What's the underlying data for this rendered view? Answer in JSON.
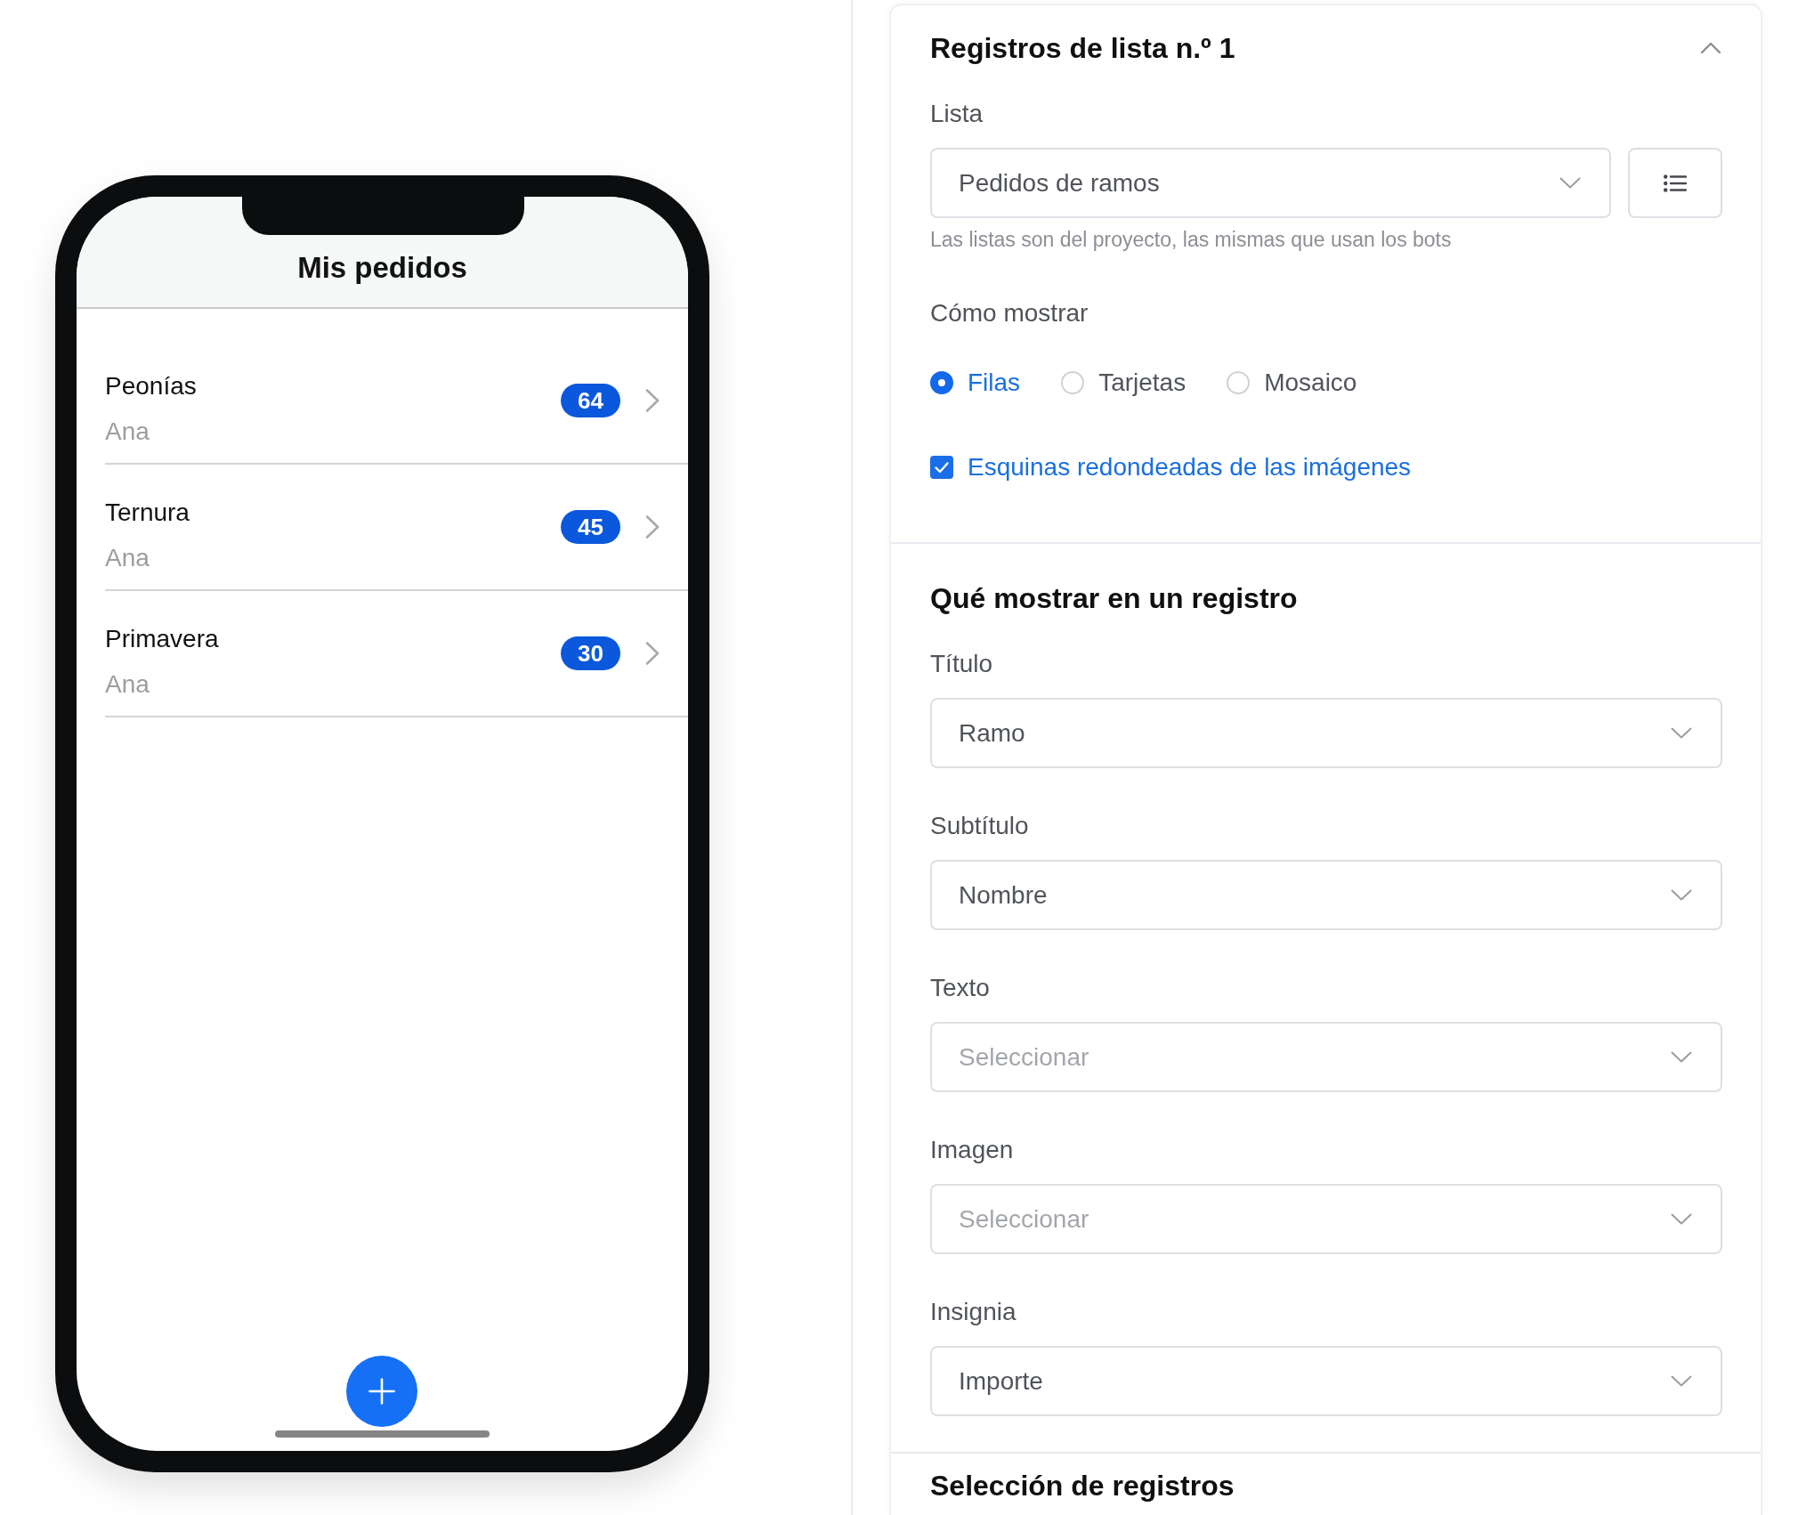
{
  "phone_preview": {
    "title": "Mis pedidos",
    "rows": [
      {
        "title": "Peonías",
        "subtitle": "Ana",
        "badge": "64"
      },
      {
        "title": "Ternura",
        "subtitle": "Ana",
        "badge": "45"
      },
      {
        "title": "Primavera",
        "subtitle": "Ana",
        "badge": "30"
      }
    ]
  },
  "list_records_section": {
    "title": "Registros de lista n.º 1",
    "expanded": true,
    "list_field": {
      "label": "Lista",
      "value": "Pedidos de ramos",
      "hint": "Las listas son del proyecto, las mismas que usan los bots"
    },
    "display_label": "Cómo mostrar",
    "display_options": [
      {
        "label": "Filas",
        "selected": true
      },
      {
        "label": "Tarjetas",
        "selected": false
      },
      {
        "label": "Mosaico",
        "selected": false
      }
    ],
    "rounded_corners": {
      "label": "Esquinas redondeadas de las imágenes",
      "checked": true
    }
  },
  "record_fields_section": {
    "title": "Qué mostrar en un registro",
    "fields": [
      {
        "label": "Título",
        "value": "Ramo"
      },
      {
        "label": "Subtítulo",
        "value": "Nombre"
      },
      {
        "label": "Texto",
        "placeholder": "Seleccionar"
      },
      {
        "label": "Imagen",
        "placeholder": "Seleccionar"
      },
      {
        "label": "Insignia",
        "value": "Importe"
      }
    ]
  },
  "record_selection_section": {
    "title": "Selección de registros"
  }
}
